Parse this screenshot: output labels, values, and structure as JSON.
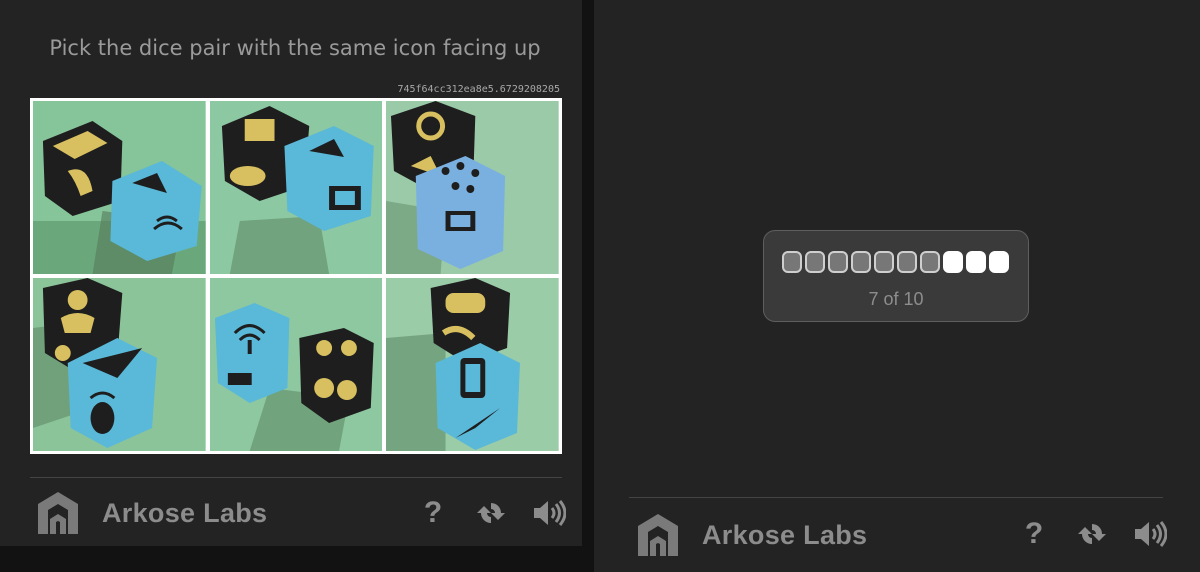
{
  "challenge": {
    "prompt": "Pick the dice pair with the same icon facing up",
    "session_id": "745f64cc312ea8e5.6729208205",
    "tiles": [
      {
        "index": 1,
        "dice": [
          "lightning",
          "satellite-dish"
        ]
      },
      {
        "index": 2,
        "dice": [
          "tv",
          "satellite-dish"
        ]
      },
      {
        "index": 3,
        "dice": [
          "recycle",
          "dots"
        ]
      },
      {
        "index": 4,
        "dice": [
          "person",
          "arrow"
        ]
      },
      {
        "index": 5,
        "dice": [
          "wifi",
          "binoculars"
        ]
      },
      {
        "index": 6,
        "dice": [
          "bullet",
          "phone"
        ]
      }
    ]
  },
  "footer_left": {
    "brand": "Arkose Labs",
    "help_label": "?",
    "icons": [
      "arkose-logo-icon",
      "refresh-icon",
      "audio-icon"
    ]
  },
  "progress": {
    "current": 7,
    "total": 10,
    "text": "7 of 10"
  },
  "footer_right": {
    "brand": "Arkose Labs",
    "help_label": "?"
  },
  "colors": {
    "panel": "#232323",
    "background": "#121212",
    "text_muted": "#8c8c8c",
    "dice_blue": "#5ab8d8",
    "dice_black": "#1e1e1e",
    "dice_icon_yellow": "#d8c060",
    "felt_green": "#7db88a"
  }
}
